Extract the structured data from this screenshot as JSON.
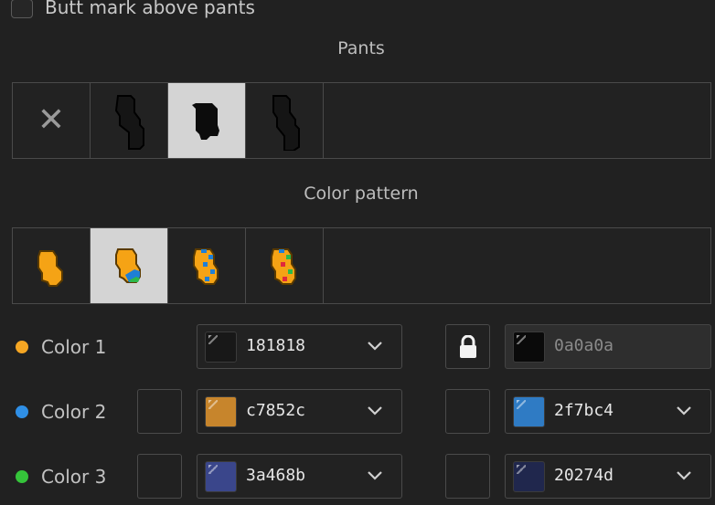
{
  "top_option": {
    "label": "Butt mark above pants",
    "checked": false
  },
  "pants": {
    "title": "Pants",
    "tiles": [
      {
        "name": "none-option",
        "selected": false
      },
      {
        "name": "pants-style-1",
        "selected": false
      },
      {
        "name": "pants-style-2",
        "selected": true
      },
      {
        "name": "pants-style-3",
        "selected": false
      }
    ]
  },
  "pattern": {
    "title": "Color pattern",
    "tiles": [
      {
        "name": "pattern-1",
        "selected": false
      },
      {
        "name": "pattern-2",
        "selected": true
      },
      {
        "name": "pattern-3",
        "selected": false
      },
      {
        "name": "pattern-4",
        "selected": false
      }
    ]
  },
  "colors": [
    {
      "label": "Color 1",
      "dot": "#f5a623",
      "primary": {
        "hex": "181818",
        "swatch": "#181818"
      },
      "secondary": {
        "hex": "0a0a0a",
        "swatch": "#0a0a0a",
        "locked": true
      }
    },
    {
      "label": "Color 2",
      "dot": "#2f8fe6",
      "primary": {
        "hex": "c7852c",
        "swatch": "#c7852c"
      },
      "secondary": {
        "hex": "2f7bc4",
        "swatch": "#2f7bc4"
      }
    },
    {
      "label": "Color 3",
      "dot": "#35c43a",
      "primary": {
        "hex": "3a468b",
        "swatch": "#3a468b"
      },
      "secondary": {
        "hex": "20274d",
        "swatch": "#20274d"
      }
    }
  ]
}
